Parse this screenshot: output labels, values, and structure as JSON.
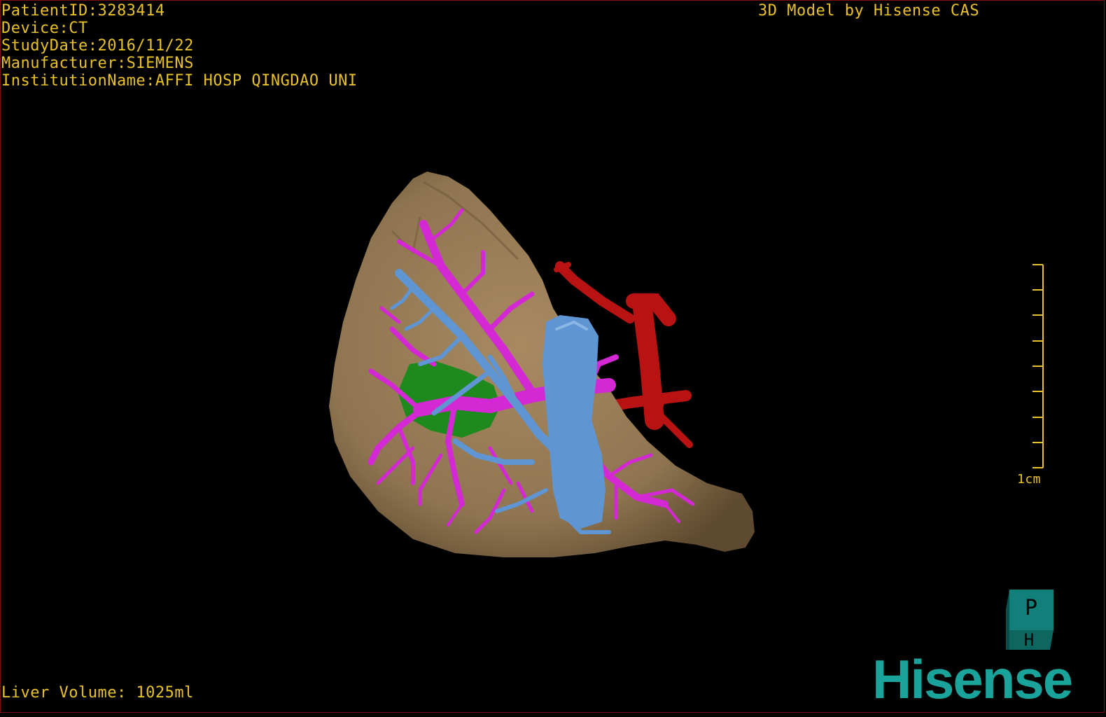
{
  "overlay": {
    "patient_id": "PatientID:3283414",
    "device": "Device:CT",
    "study_date": "StudyDate:2016/11/22",
    "manufacturer": "Manufacturer:SIEMENS",
    "institution": "InstitutionName:AFFI HOSP QINGDAO UNI",
    "credit": "3D Model by Hisense CAS",
    "liver_volume": "Liver Volume: 1025ml"
  },
  "scale_bar": {
    "label": "1cm"
  },
  "logo": {
    "cube_top": "P",
    "cube_front": "H",
    "brand": "Hisense"
  },
  "colors": {
    "overlay_text": "#e8c227",
    "liver": "#9c7f57",
    "hepatic_vein": "#d428d4",
    "portal_vein": "#5f95d2",
    "artery": "#b81212",
    "gallbladder": "#1e8a1e",
    "brand": "#1aa39a"
  }
}
